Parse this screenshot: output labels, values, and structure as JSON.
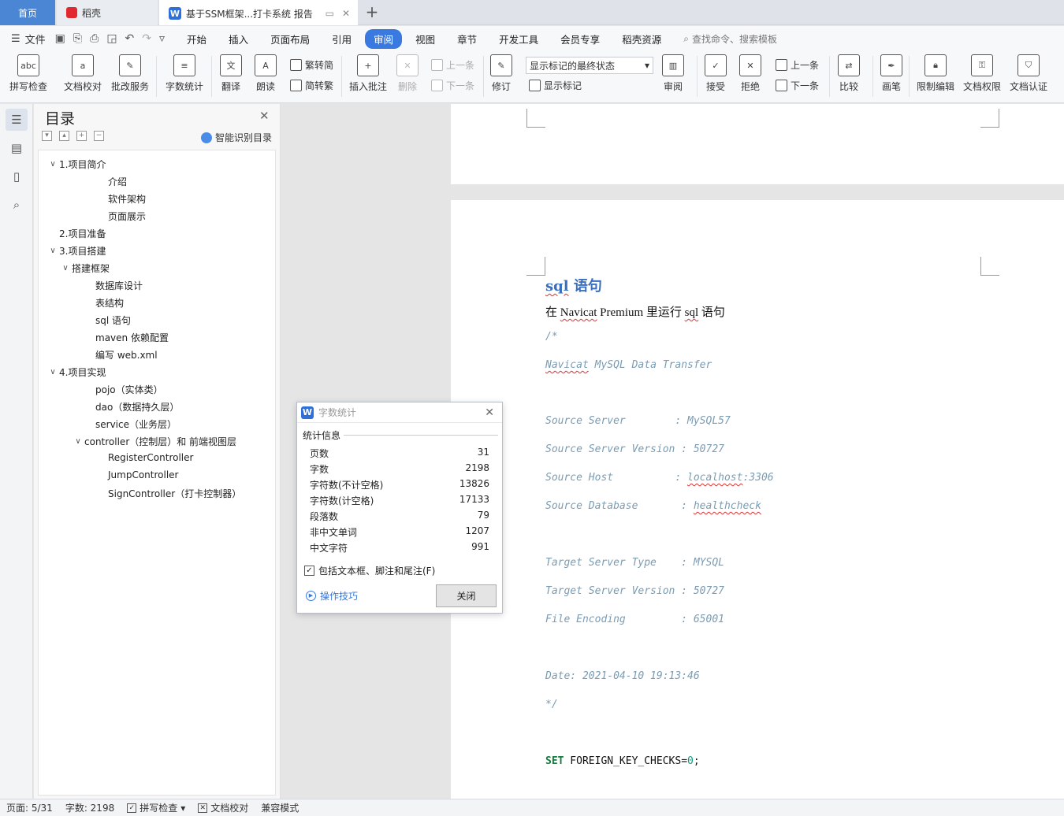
{
  "tabs": {
    "home": "首页",
    "daoke": "稻壳",
    "doc": "基于SSM框架...打卡系统 报告",
    "new": "+"
  },
  "menu": {
    "file": "文件",
    "items": [
      "开始",
      "插入",
      "页面布局",
      "引用",
      "审阅",
      "视图",
      "章节",
      "开发工具",
      "会员专享",
      "稻壳资源"
    ],
    "active": "审阅",
    "search_placeholder": "查找命令、搜索模板"
  },
  "ribbon": {
    "spell_check": "拼写检查",
    "doc_proof": "文档校对",
    "revise_service": "批改服务",
    "word_count": "字数统计",
    "translate": "翻译",
    "read_aloud": "朗读",
    "trad_conv": "繁转简",
    "simp_conv": "简转繁",
    "insert_comment": "插入批注",
    "delete": "删除",
    "prev_comment": "上一条",
    "next_comment": "下一条",
    "track_changes": "修订",
    "markup_select": "显示标记的最终状态",
    "show_markup": "显示标记",
    "review": "审阅",
    "accept": "接受",
    "reject": "拒绝",
    "prev_change": "上一条",
    "next_change": "下一条",
    "compare": "比较",
    "pen": "画笔",
    "restrict_edit": "限制编辑",
    "doc_rights": "文档权限",
    "doc_auth": "文档认证"
  },
  "toc": {
    "title": "目录",
    "smart": "智能识别目录",
    "items": [
      {
        "text": "1.项目简介",
        "level": 0,
        "chev": "v"
      },
      {
        "text": "介绍",
        "level": 2
      },
      {
        "text": "软件架构",
        "level": 2
      },
      {
        "text": "页面展示",
        "level": 2
      },
      {
        "text": "2.项目准备",
        "level": 0
      },
      {
        "text": "3.项目搭建",
        "level": 0,
        "chev": "v"
      },
      {
        "text": "搭建框架",
        "level": 1,
        "chev": "v"
      },
      {
        "text": "数据库设计",
        "level": 1.5
      },
      {
        "text": "表结构",
        "level": 1.5
      },
      {
        "text": "sql 语句",
        "level": 1.5
      },
      {
        "text": "maven 依赖配置",
        "level": 1.5
      },
      {
        "text": "编写 web.xml",
        "level": 1.5
      },
      {
        "text": "4.项目实现",
        "level": 0,
        "chev": "v"
      },
      {
        "text": "pojo（实体类）",
        "level": 1.5
      },
      {
        "text": "dao（数据持久层）",
        "level": 1.5
      },
      {
        "text": "service（业务层）",
        "level": 1.5
      },
      {
        "text": "controller（控制层）和 前端视图层",
        "level": 1,
        "chev": "v",
        "offset": 16
      },
      {
        "text": "RegisterController",
        "level": 2
      },
      {
        "text": "JumpController",
        "level": 2
      },
      {
        "text": "SignController（打卡控制器）",
        "level": 2
      }
    ]
  },
  "doc": {
    "heading_a": "sql",
    "heading_b": " 语句",
    "line1_a": "在 ",
    "line1_b": "Navicat",
    "line1_c": " Premium 里运行 ",
    "line1_d": "sql",
    "line1_e": " 语句",
    "comment_open": "/*",
    "navicat_a": "Navicat",
    "navicat_b": " MySQL Data Transfer",
    "source_server": "Source Server        : MySQL57",
    "source_version": "Source Server Version : 50727",
    "source_host_a": "Source Host          : ",
    "source_host_b": "localhost",
    "source_host_c": ":3306",
    "source_db_a": "Source Database       : ",
    "source_db_b": "healthcheck",
    "target_type": "Target Server Type    : MYSQL",
    "target_version": "Target Server Version : 50727",
    "file_encoding": "File Encoding         : 65001",
    "date": "Date: 2021-04-10 19:13:46",
    "comment_close": "*/",
    "sql_kw": "SET",
    "sql_body": " FOREIGN_KEY_CHECKS=",
    "sql_num": "0",
    "sql_end": ";"
  },
  "dialog": {
    "title": "字数统计",
    "section": "统计信息",
    "stats": [
      {
        "label": "页数",
        "value": "31"
      },
      {
        "label": "字数",
        "value": "2198"
      },
      {
        "label": "字符数(不计空格)",
        "value": "13826"
      },
      {
        "label": "字符数(计空格)",
        "value": "17133"
      },
      {
        "label": "段落数",
        "value": "79"
      },
      {
        "label": "非中文单词",
        "value": "1207"
      },
      {
        "label": "中文字符",
        "value": "991"
      }
    ],
    "include": "包括文本框、脚注和尾注(F)",
    "tips": "操作技巧",
    "close": "关闭"
  },
  "status": {
    "page": "页面: 5/31",
    "words": "字数: 2198",
    "spell": "拼写检查",
    "proof": "文档校对",
    "compat": "兼容模式"
  },
  "colors": {
    "accent": "#3a7ae0",
    "home_tab": "#4a86d4",
    "heading": "#3a6fbf",
    "code": "#7a9cb3"
  }
}
